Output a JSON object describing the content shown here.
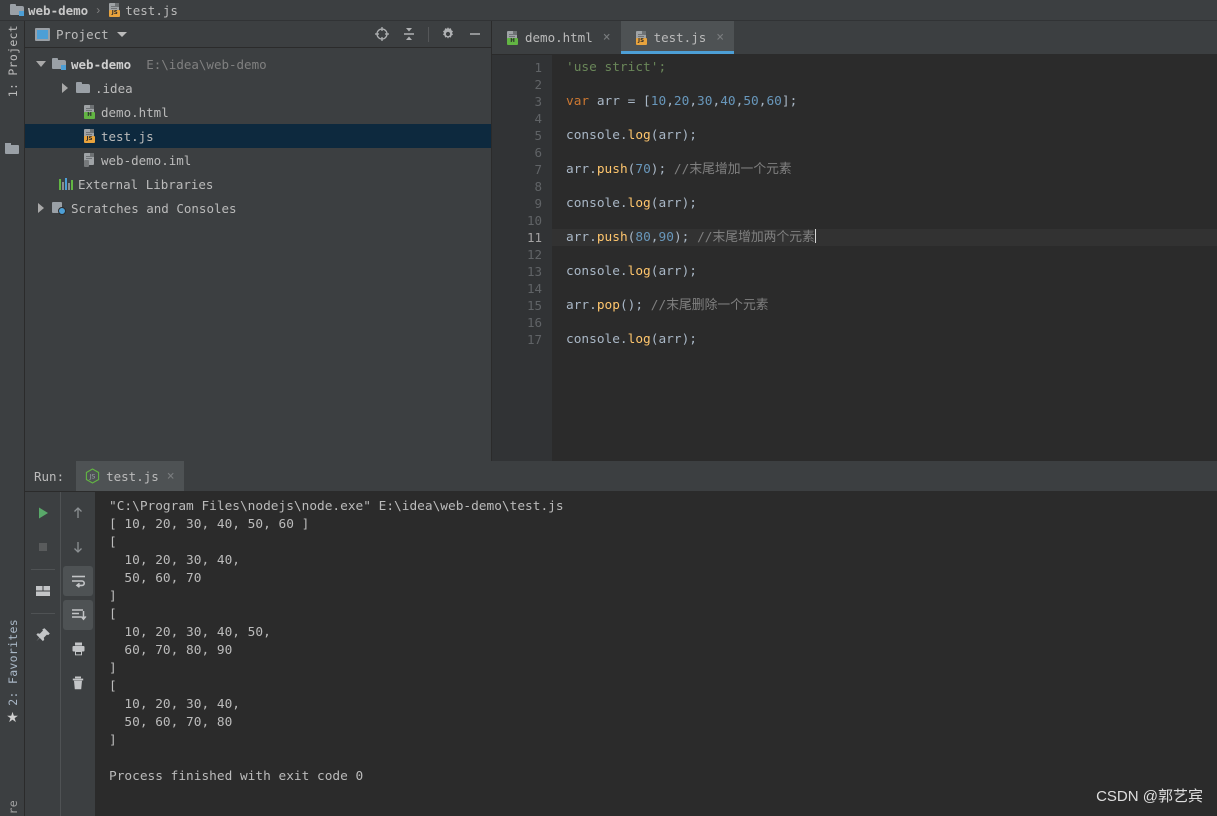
{
  "breadcrumb": {
    "items": [
      {
        "label": "web-demo",
        "icon": "folder-icon",
        "bold": true
      },
      {
        "label": "test.js",
        "icon": "js-file-icon",
        "bold": false
      }
    ],
    "separator": "›"
  },
  "left_strip": {
    "project_tab": "1: Project",
    "favorites_tab": "2: Favorites",
    "structure_tab": "re",
    "favorites_icon": "★"
  },
  "project_panel": {
    "title": "Project",
    "caret_icon": "chevron-down-icon",
    "tools": [
      {
        "name": "locate-icon",
        "label": "Select Opened File"
      },
      {
        "name": "collapse-all-icon",
        "label": "Collapse All"
      },
      {
        "name": "gear-icon",
        "label": "Settings"
      },
      {
        "name": "minimize-icon",
        "label": "Hide"
      }
    ],
    "tree": [
      {
        "label": "web-demo",
        "path": "E:\\idea\\web-demo",
        "icon": "folder-icon",
        "arrow": "down",
        "indent": 1,
        "bold": true,
        "selected": false
      },
      {
        "label": ".idea",
        "path": "",
        "icon": "folder-plain-icon",
        "arrow": "right",
        "indent": 2,
        "bold": false,
        "selected": false
      },
      {
        "label": "demo.html",
        "path": "",
        "icon": "html-file-icon",
        "arrow": "none",
        "indent": 3,
        "bold": false,
        "selected": false
      },
      {
        "label": "test.js",
        "path": "",
        "icon": "js-file-icon",
        "arrow": "none",
        "indent": 3,
        "bold": false,
        "selected": true
      },
      {
        "label": "web-demo.iml",
        "path": "",
        "icon": "iml-file-icon",
        "arrow": "none",
        "indent": 3,
        "bold": false,
        "selected": false
      },
      {
        "label": "External Libraries",
        "path": "",
        "icon": "libraries-icon",
        "arrow": "none",
        "indent": 2,
        "bold": false,
        "selected": false
      },
      {
        "label": "Scratches and Consoles",
        "path": "",
        "icon": "scratches-icon",
        "arrow": "right",
        "indent": 1,
        "bold": false,
        "selected": false
      }
    ]
  },
  "editor": {
    "tabs": [
      {
        "label": "demo.html",
        "icon": "html-file-icon",
        "active": false,
        "close": "×"
      },
      {
        "label": "test.js",
        "icon": "js-file-icon",
        "active": true,
        "close": "×"
      }
    ],
    "current_line": 11,
    "lines": [
      {
        "n": 1,
        "tokens": [
          {
            "t": "'use strict';",
            "c": "tok-str"
          }
        ]
      },
      {
        "n": 2,
        "tokens": []
      },
      {
        "n": 3,
        "tokens": [
          {
            "t": "var",
            "c": "tok-kw"
          },
          {
            "t": " arr = [",
            "c": "tok-pl"
          },
          {
            "t": "10",
            "c": "tok-num"
          },
          {
            "t": ",",
            "c": "tok-pl"
          },
          {
            "t": "20",
            "c": "tok-num"
          },
          {
            "t": ",",
            "c": "tok-pl"
          },
          {
            "t": "30",
            "c": "tok-num"
          },
          {
            "t": ",",
            "c": "tok-pl"
          },
          {
            "t": "40",
            "c": "tok-num"
          },
          {
            "t": ",",
            "c": "tok-pl"
          },
          {
            "t": "50",
            "c": "tok-num"
          },
          {
            "t": ",",
            "c": "tok-pl"
          },
          {
            "t": "60",
            "c": "tok-num"
          },
          {
            "t": "];",
            "c": "tok-pl"
          }
        ]
      },
      {
        "n": 4,
        "tokens": []
      },
      {
        "n": 5,
        "tokens": [
          {
            "t": "console.",
            "c": "tok-pl"
          },
          {
            "t": "log",
            "c": "tok-fn"
          },
          {
            "t": "(arr);",
            "c": "tok-pl"
          }
        ]
      },
      {
        "n": 6,
        "tokens": []
      },
      {
        "n": 7,
        "tokens": [
          {
            "t": "arr.",
            "c": "tok-pl"
          },
          {
            "t": "push",
            "c": "tok-fn"
          },
          {
            "t": "(",
            "c": "tok-pl"
          },
          {
            "t": "70",
            "c": "tok-num"
          },
          {
            "t": "); ",
            "c": "tok-pl"
          },
          {
            "t": "//末尾增加一个元素",
            "c": "tok-cmt"
          }
        ]
      },
      {
        "n": 8,
        "tokens": []
      },
      {
        "n": 9,
        "tokens": [
          {
            "t": "console.",
            "c": "tok-pl"
          },
          {
            "t": "log",
            "c": "tok-fn"
          },
          {
            "t": "(arr);",
            "c": "tok-pl"
          }
        ]
      },
      {
        "n": 10,
        "tokens": []
      },
      {
        "n": 11,
        "tokens": [
          {
            "t": "arr.",
            "c": "tok-pl"
          },
          {
            "t": "push",
            "c": "tok-fn"
          },
          {
            "t": "(",
            "c": "tok-pl"
          },
          {
            "t": "80",
            "c": "tok-num"
          },
          {
            "t": ",",
            "c": "tok-pl"
          },
          {
            "t": "90",
            "c": "tok-num"
          },
          {
            "t": "); ",
            "c": "tok-pl"
          },
          {
            "t": "//末尾增加两个元素",
            "c": "tok-cmt"
          }
        ]
      },
      {
        "n": 12,
        "tokens": []
      },
      {
        "n": 13,
        "tokens": [
          {
            "t": "console.",
            "c": "tok-pl"
          },
          {
            "t": "log",
            "c": "tok-fn"
          },
          {
            "t": "(arr);",
            "c": "tok-pl"
          }
        ]
      },
      {
        "n": 14,
        "tokens": []
      },
      {
        "n": 15,
        "tokens": [
          {
            "t": "arr.",
            "c": "tok-pl"
          },
          {
            "t": "pop",
            "c": "tok-fn"
          },
          {
            "t": "(); ",
            "c": "tok-pl"
          },
          {
            "t": "//末尾删除一个元素",
            "c": "tok-cmt"
          }
        ]
      },
      {
        "n": 16,
        "tokens": []
      },
      {
        "n": 17,
        "tokens": [
          {
            "t": "console.",
            "c": "tok-pl"
          },
          {
            "t": "log",
            "c": "tok-fn"
          },
          {
            "t": "(arr);",
            "c": "tok-pl"
          }
        ]
      }
    ]
  },
  "run_panel": {
    "label": "Run:",
    "tab": {
      "label": "test.js",
      "icon": "nodejs-icon",
      "close": "×"
    },
    "toolbar_left": [
      {
        "name": "run-button",
        "icon": "play-icon"
      },
      {
        "name": "stop-button",
        "icon": "stop-icon"
      },
      {
        "name": "layout-button",
        "icon": "restore-layout-icon"
      },
      {
        "name": "pin-button",
        "icon": "pin-icon"
      }
    ],
    "toolbar_right": [
      {
        "name": "up-button",
        "icon": "arrow-up-icon"
      },
      {
        "name": "down-button",
        "icon": "arrow-down-icon"
      },
      {
        "name": "soft-wrap-button",
        "icon": "soft-wrap-icon",
        "active": true
      },
      {
        "name": "scroll-end-button",
        "icon": "scroll-to-end-icon",
        "active": true
      },
      {
        "name": "print-button",
        "icon": "print-icon"
      },
      {
        "name": "clear-all-button",
        "icon": "trash-icon"
      }
    ],
    "console_output": [
      "\"C:\\Program Files\\nodejs\\node.exe\" E:\\idea\\web-demo\\test.js",
      "[ 10, 20, 30, 40, 50, 60 ]",
      "[",
      "  10, 20, 30, 40,",
      "  50, 60, 70",
      "]",
      "[",
      "  10, 20, 30, 40, 50,",
      "  60, 70, 80, 90",
      "]",
      "[",
      "  10, 20, 30, 40,",
      "  50, 60, 70, 80",
      "]",
      "",
      "Process finished with exit code 0"
    ]
  },
  "watermark": "CSDN @郭艺宾",
  "colors": {
    "accent": "#4d9fd6",
    "selection": "#0d293e",
    "editor_bg": "#2b2b2b",
    "panel_bg": "#3c3f41",
    "string": "#6a8759",
    "keyword": "#cc7832",
    "number": "#6897bb",
    "function": "#ffc66d",
    "comment": "#808080",
    "run_green": "#59a869"
  }
}
